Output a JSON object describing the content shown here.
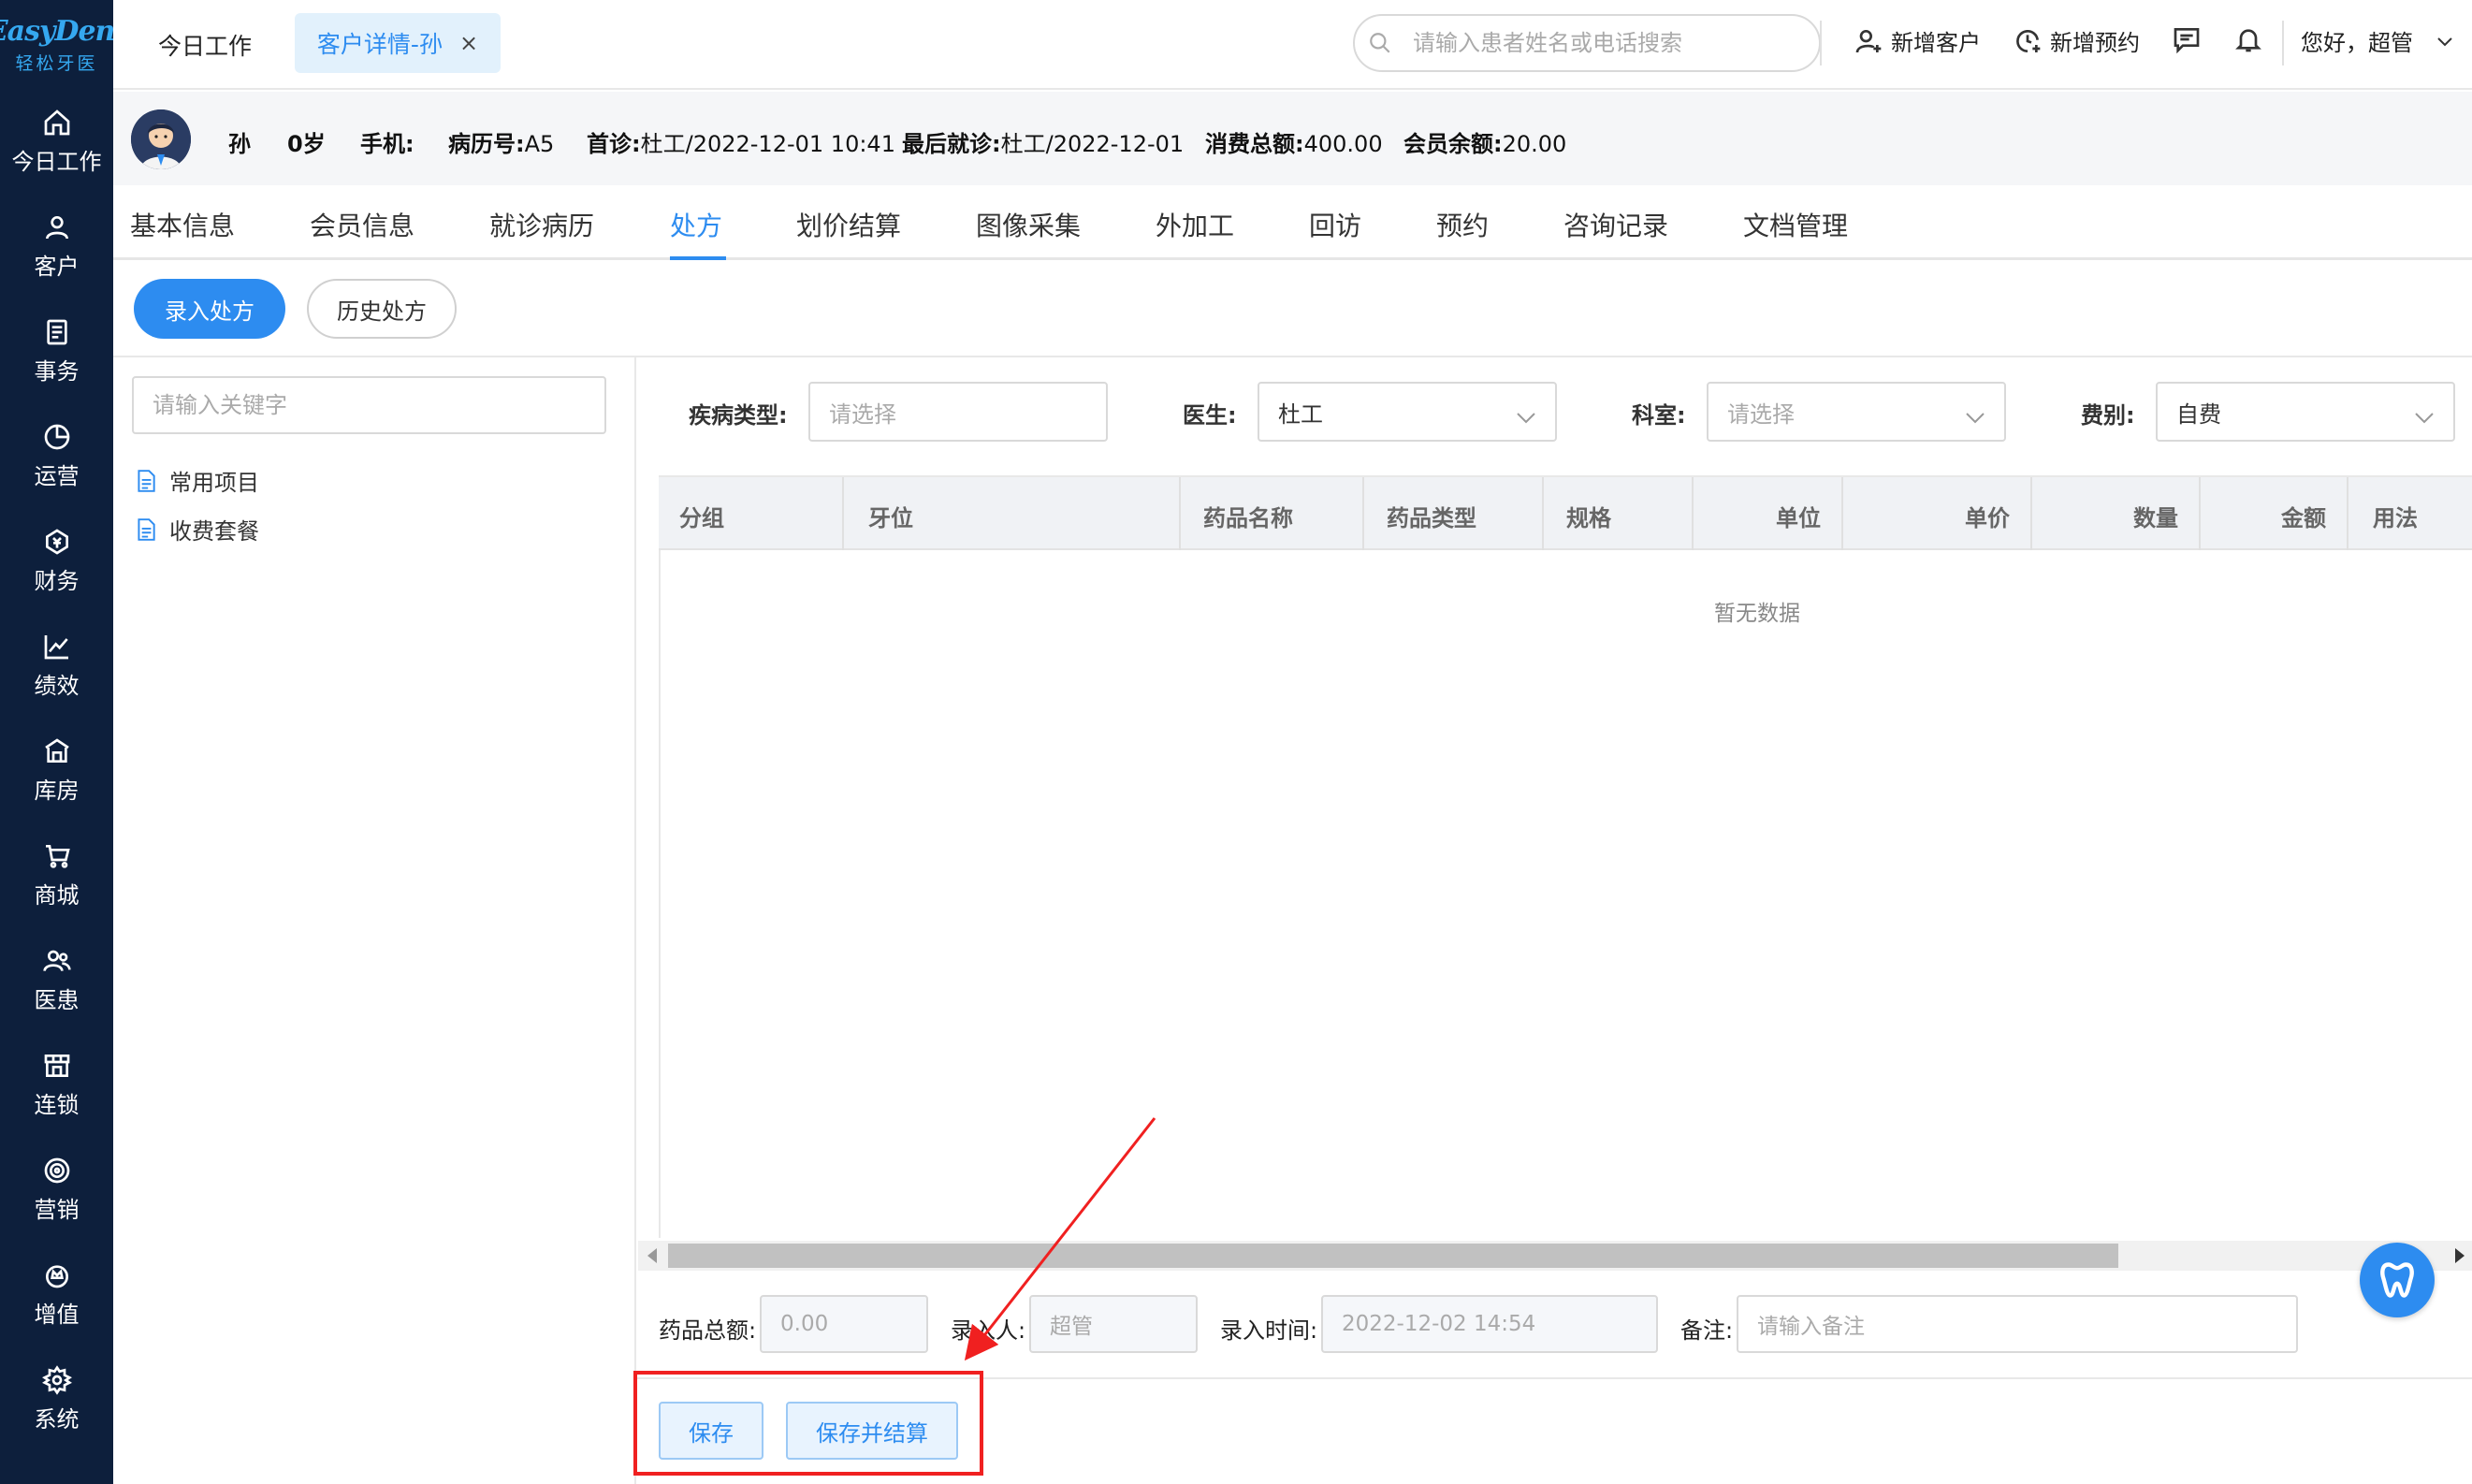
{
  "logo": {
    "main": "EasyDent",
    "sub": "轻松牙医"
  },
  "sidebar": {
    "items": [
      {
        "label": "今日工作",
        "icon": "home-icon"
      },
      {
        "label": "客户",
        "icon": "user-icon"
      },
      {
        "label": "事务",
        "icon": "document-icon"
      },
      {
        "label": "运营",
        "icon": "pie-chart-icon"
      },
      {
        "label": "财务",
        "icon": "money-icon"
      },
      {
        "label": "绩效",
        "icon": "line-chart-icon"
      },
      {
        "label": "库房",
        "icon": "warehouse-icon"
      },
      {
        "label": "商城",
        "icon": "cart-icon"
      },
      {
        "label": "医患",
        "icon": "people-icon"
      },
      {
        "label": "连锁",
        "icon": "store-icon"
      },
      {
        "label": "营销",
        "icon": "target-icon"
      },
      {
        "label": "增值",
        "icon": "crown-icon"
      },
      {
        "label": "系统",
        "icon": "gear-icon"
      }
    ]
  },
  "topbar": {
    "tab_today": "今日工作",
    "tab_active": "客户详情-孙",
    "tab_close": "×",
    "search_placeholder": "请输入患者姓名或电话搜索",
    "new_customer": "新增客户",
    "new_appointment": "新增预约",
    "greeting": "您好，超管"
  },
  "patient": {
    "name": "孙",
    "age": "0岁",
    "phone_label": "手机:",
    "record_label": "病历号:",
    "record_value": "A5",
    "first_visit_label": "首诊:",
    "first_visit_value": "杜工/2022-12-01 10:41",
    "last_visit_label": "最后就诊:",
    "last_visit_value": "杜工/2022-12-01",
    "total_spent_label": "消费总额:",
    "total_spent_value": "400.00",
    "balance_label": "会员余额:",
    "balance_value": "20.00"
  },
  "main_tabs": [
    "基本信息",
    "会员信息",
    "就诊病历",
    "处方",
    "划价结算",
    "图像采集",
    "外加工",
    "回访",
    "预约",
    "咨询记录",
    "文档管理"
  ],
  "active_main_tab": "处方",
  "sub_tabs": {
    "entry": "录入处方",
    "history": "历史处方"
  },
  "left_panel": {
    "keyword_placeholder": "请输入关键字",
    "items": [
      "常用项目",
      "收费套餐"
    ]
  },
  "filters": {
    "disease_label": "疾病类型:",
    "disease_placeholder": "请选择",
    "doctor_label": "医生:",
    "doctor_value": "杜工",
    "dept_label": "科室:",
    "dept_placeholder": "请选择",
    "fee_label": "费别:",
    "fee_value": "自费"
  },
  "table": {
    "columns": [
      "分组",
      "牙位",
      "药品名称",
      "药品类型",
      "规格",
      "单位",
      "单价",
      "数量",
      "金额",
      "用法"
    ],
    "rows": [],
    "empty_text": "暂无数据"
  },
  "bottom_form": {
    "total_label": "药品总额:",
    "total_value": "0.00",
    "entered_by_label": "录入人:",
    "entered_by_value": "超管",
    "entered_time_label": "录入时间:",
    "entered_time_value": "2022-12-02 14:54",
    "remark_label": "备注:",
    "remark_placeholder": "请输入备注"
  },
  "actions": {
    "save": "保存",
    "save_and_settle": "保存并结算"
  },
  "colors": {
    "sidebar_bg": "#0d1f3c",
    "accent": "#2d8cf0",
    "annotation": "#f02020"
  }
}
